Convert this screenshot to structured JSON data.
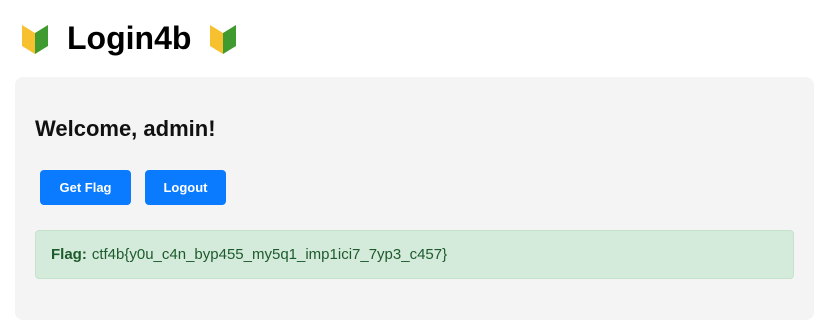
{
  "header": {
    "title": "Login4b",
    "left_icon": "beginner-mark-icon",
    "right_icon": "beginner-mark-icon"
  },
  "main": {
    "welcome_text": "Welcome, admin!",
    "buttons": {
      "get_flag": "Get Flag",
      "logout": "Logout"
    },
    "flag": {
      "label": "Flag:",
      "value": "ctf4b{y0u_c4n_byp455_my5q1_imp1ici7_7yp3_c457}"
    }
  },
  "colors": {
    "button": "#0a7bff",
    "flag_bg": "#d4eadb",
    "flag_text": "#1d5b2c",
    "card_bg": "#f4f4f4",
    "icon_yellow": "#f6c02e",
    "icon_green": "#3f9a2f"
  }
}
